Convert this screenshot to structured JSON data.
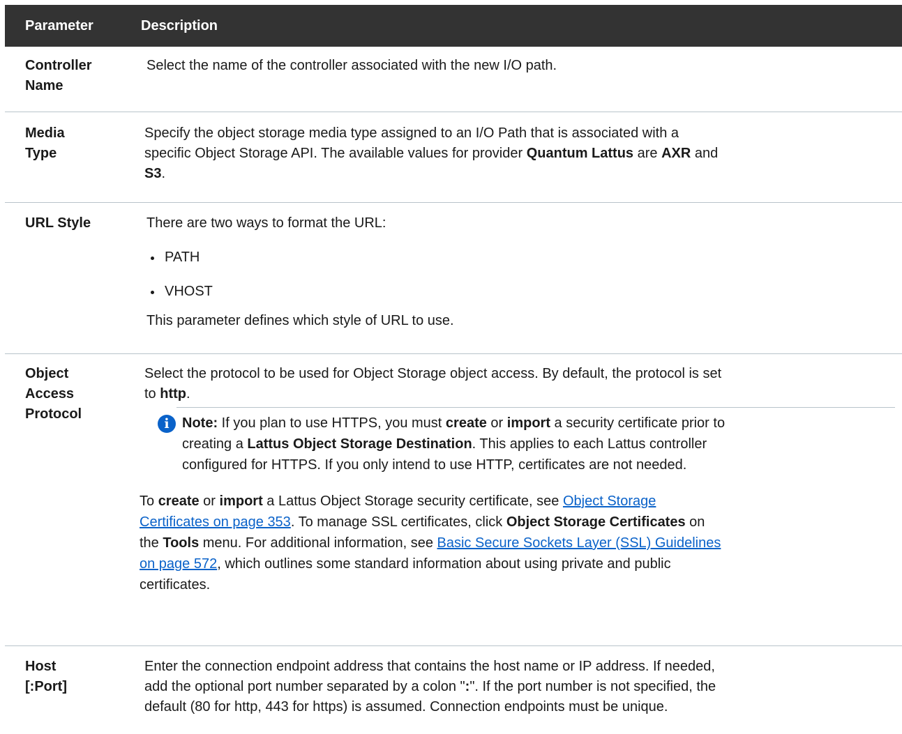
{
  "header": {
    "col1": "Parameter",
    "col2": "Description"
  },
  "rows": {
    "controller": {
      "name_line1": "Controller",
      "name_line2": "Name",
      "desc": "Select the name of the controller associated with the new I/O path."
    },
    "media": {
      "name_line1": "Media",
      "name_line2": "Type",
      "desc_line1": "Specify the object storage media type assigned to an I/O Path that is associated with a",
      "desc_line2_a": "specific Object Storage API. The available values for provider ",
      "desc_line2_b": "Quantum Lattus",
      "desc_line2_c": " are ",
      "desc_line2_d": "AXR",
      "desc_line2_e": " and",
      "desc_line3_a": "S3",
      "desc_line3_b": "."
    },
    "url_style": {
      "name": "URL Style",
      "intro": "There are two ways to format the URL:",
      "bullets": [
        "PATH",
        "VHOST"
      ],
      "outro": "This parameter defines which style of URL to use."
    },
    "protocol": {
      "name_line1": "Object",
      "name_line2": "Access",
      "name_line3": "Protocol",
      "desc_line1": "Select the protocol to be used for Object Storage object access. By default, the protocol is set",
      "desc_line2_a": "to ",
      "desc_line2_b": "http",
      "desc_line2_c": ".",
      "note": {
        "label": "Note:",
        "l1_a": " If you plan to use HTTPS, you must ",
        "l1_b": "create",
        "l1_c": " or ",
        "l1_d": "import",
        "l1_e": " a security certificate prior to",
        "l2_a": "creating a ",
        "l2_b": "Lattus Object Storage Destination",
        "l2_c": ". This applies to each Lattus controller",
        "l3": "configured for HTTPS. If you only intend to use HTTP, certificates are not needed."
      },
      "p2": {
        "l1_a": "To ",
        "l1_b": "create",
        "l1_c": " or ",
        "l1_d": "import",
        "l1_e": " a Lattus Object Storage security certificate, see ",
        "link1_part1": "Object Storage",
        "link1_part2": "Certificates on page 353",
        "l2_a": ". To manage SSL certificates, click ",
        "l2_b": "Object Storage Certificates",
        "l2_c": " on",
        "l3_a": "the ",
        "l3_b": "Tools",
        "l3_c": " menu. For additional information, see ",
        "link2_part1": "Basic Secure Sockets Layer (SSL) Guidelines",
        "link2_part2": "on page 572",
        "l4_b": ", which outlines some standard information about using private and public",
        "l5": "certificates."
      }
    },
    "host": {
      "name_line1": "Host",
      "name_line2": "[:Port]",
      "l1": "Enter the connection endpoint address that contains the host name or IP address. If needed,",
      "l2_a": "add the optional port number separated by a colon \"",
      "l2_b": ":",
      "l2_c": "\". If the port number is not specified, the",
      "l3": "default (80 for http, 443 for https) is assumed. Connection endpoints must be unique."
    }
  },
  "icons": {
    "note": "info-icon"
  },
  "colors": {
    "header_bg": "#333333",
    "link": "#0a62c9",
    "divider": "#b8c3ca"
  }
}
